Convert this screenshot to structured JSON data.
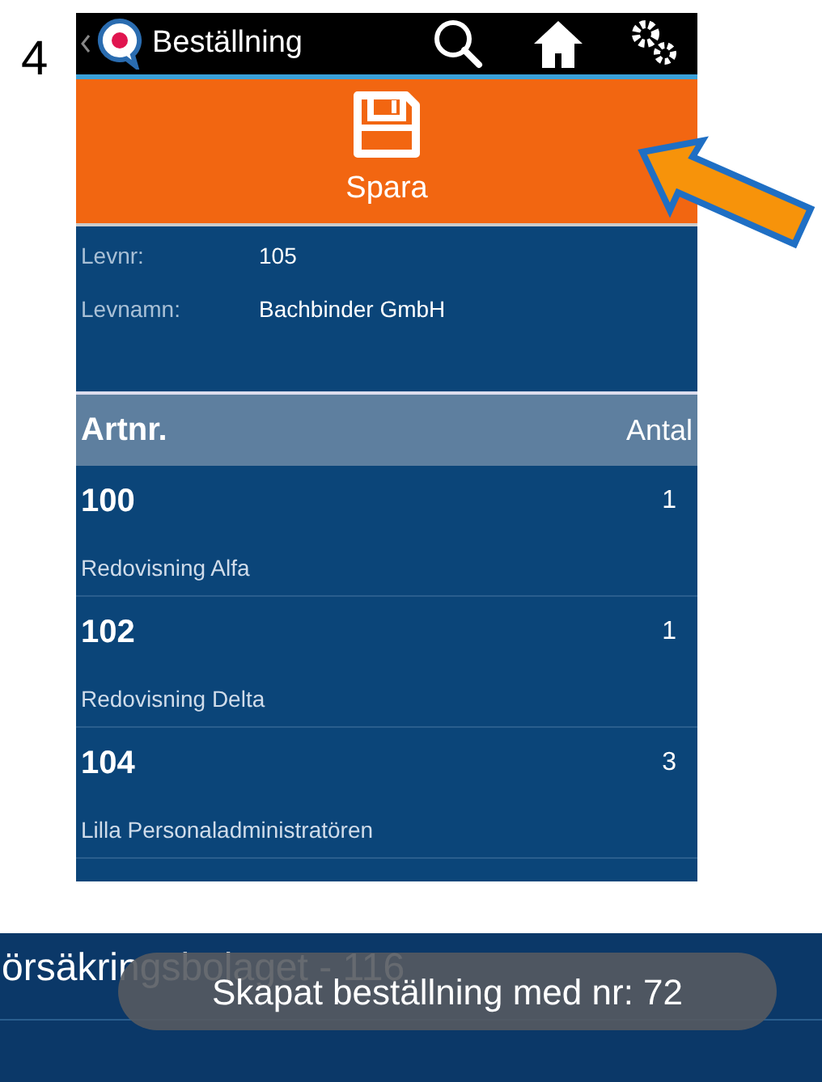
{
  "step_number": "4",
  "app_bar": {
    "title": "Beställning"
  },
  "save_button": {
    "label": "Spara"
  },
  "supplier": [
    {
      "label": "Levnr:",
      "value": "105"
    },
    {
      "label": "Levnamn:",
      "value": "Bachbinder GmbH"
    }
  ],
  "table": {
    "columns": [
      "Artnr.",
      "Antal"
    ],
    "rows": [
      {
        "artnr": "100",
        "antal": "1",
        "description": "Redovisning Alfa"
      },
      {
        "artnr": "102",
        "antal": "1",
        "description": "Redovisning Delta"
      },
      {
        "artnr": "104",
        "antal": "3",
        "description": "Lilla Personaladministratören"
      }
    ]
  },
  "second_screen": {
    "list_item": "örsäkringsbolaget - 116",
    "toast": "Skapat beställning med nr: 72"
  }
}
